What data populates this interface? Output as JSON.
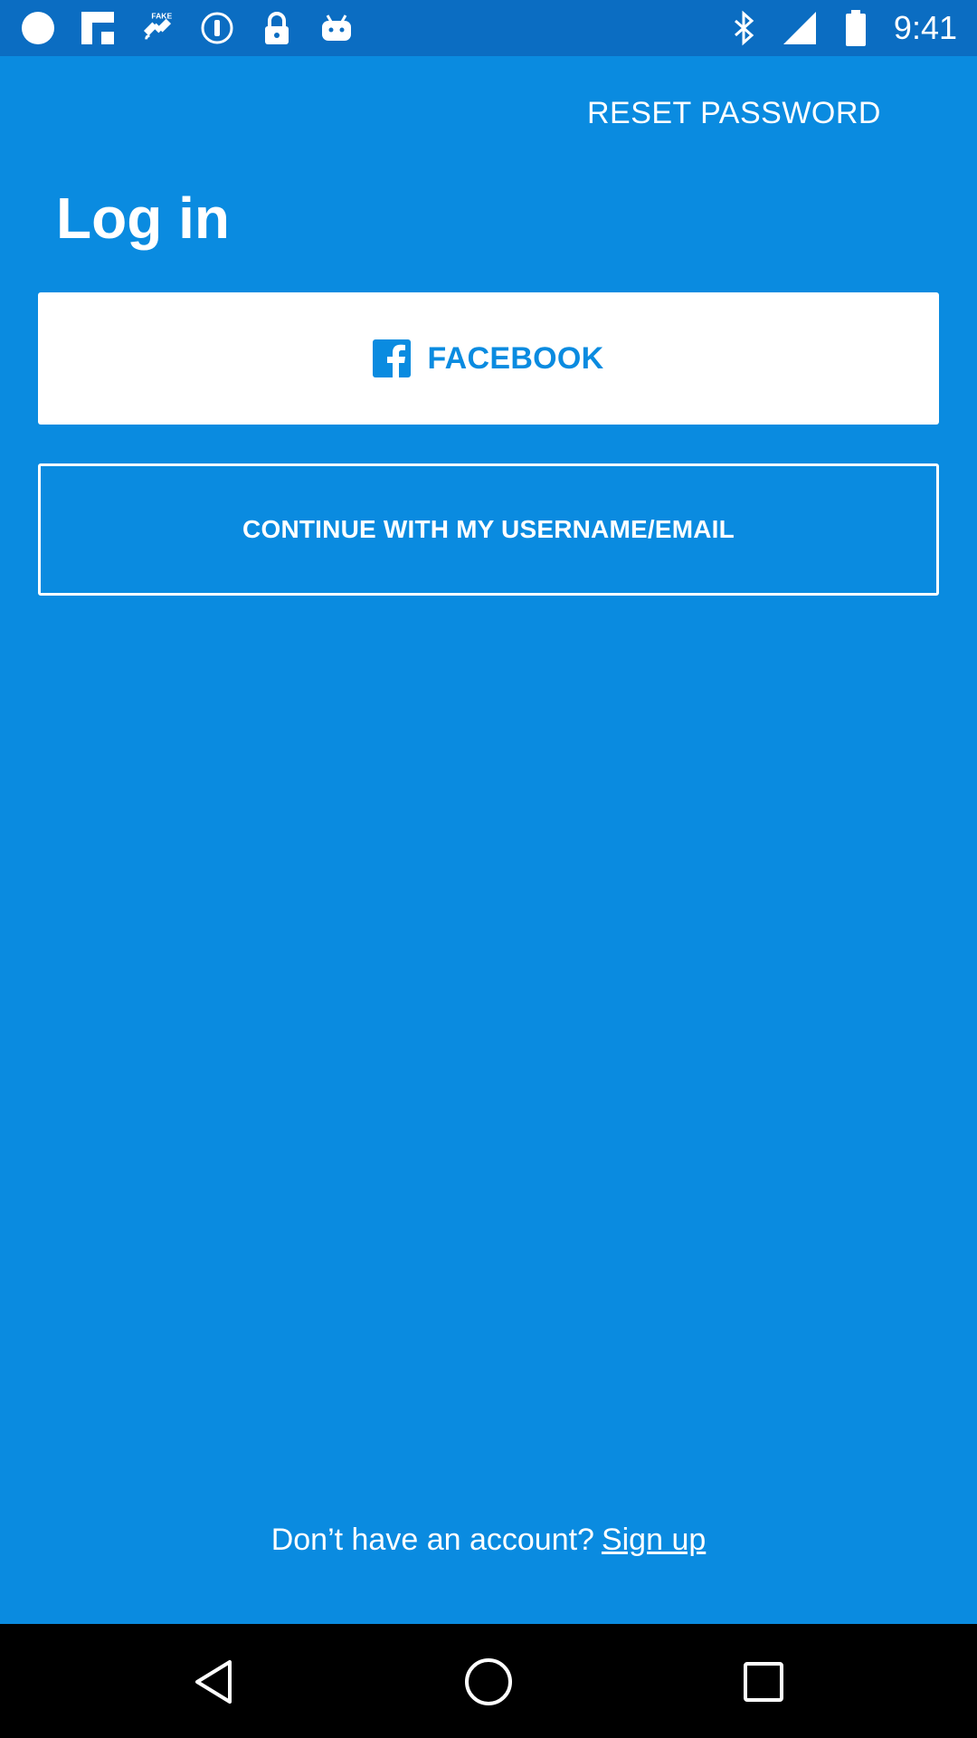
{
  "status_bar": {
    "time": "9:41",
    "left_icons": [
      "circle-icon",
      "flipboard-icon",
      "fake-gps-icon",
      "info-icon",
      "lock-icon",
      "android-icon"
    ],
    "right_icons": [
      "bluetooth-icon",
      "signal-icon",
      "battery-icon"
    ]
  },
  "header": {
    "reset_password_label": "RESET PASSWORD",
    "title": "Log in"
  },
  "buttons": {
    "facebook_label": "FACEBOOK",
    "email_label": "CONTINUE WITH MY USERNAME/EMAIL"
  },
  "footer": {
    "prompt": "Don’t have an account?",
    "signup_label": "Sign up"
  },
  "colors": {
    "background": "#0A8BE0",
    "status_bar": "#0B6DC2",
    "text": "#FFFFFF",
    "facebook_text": "#0A8BE0"
  },
  "nav_bar": {
    "icons": [
      "back-icon",
      "home-icon",
      "recents-icon"
    ]
  }
}
